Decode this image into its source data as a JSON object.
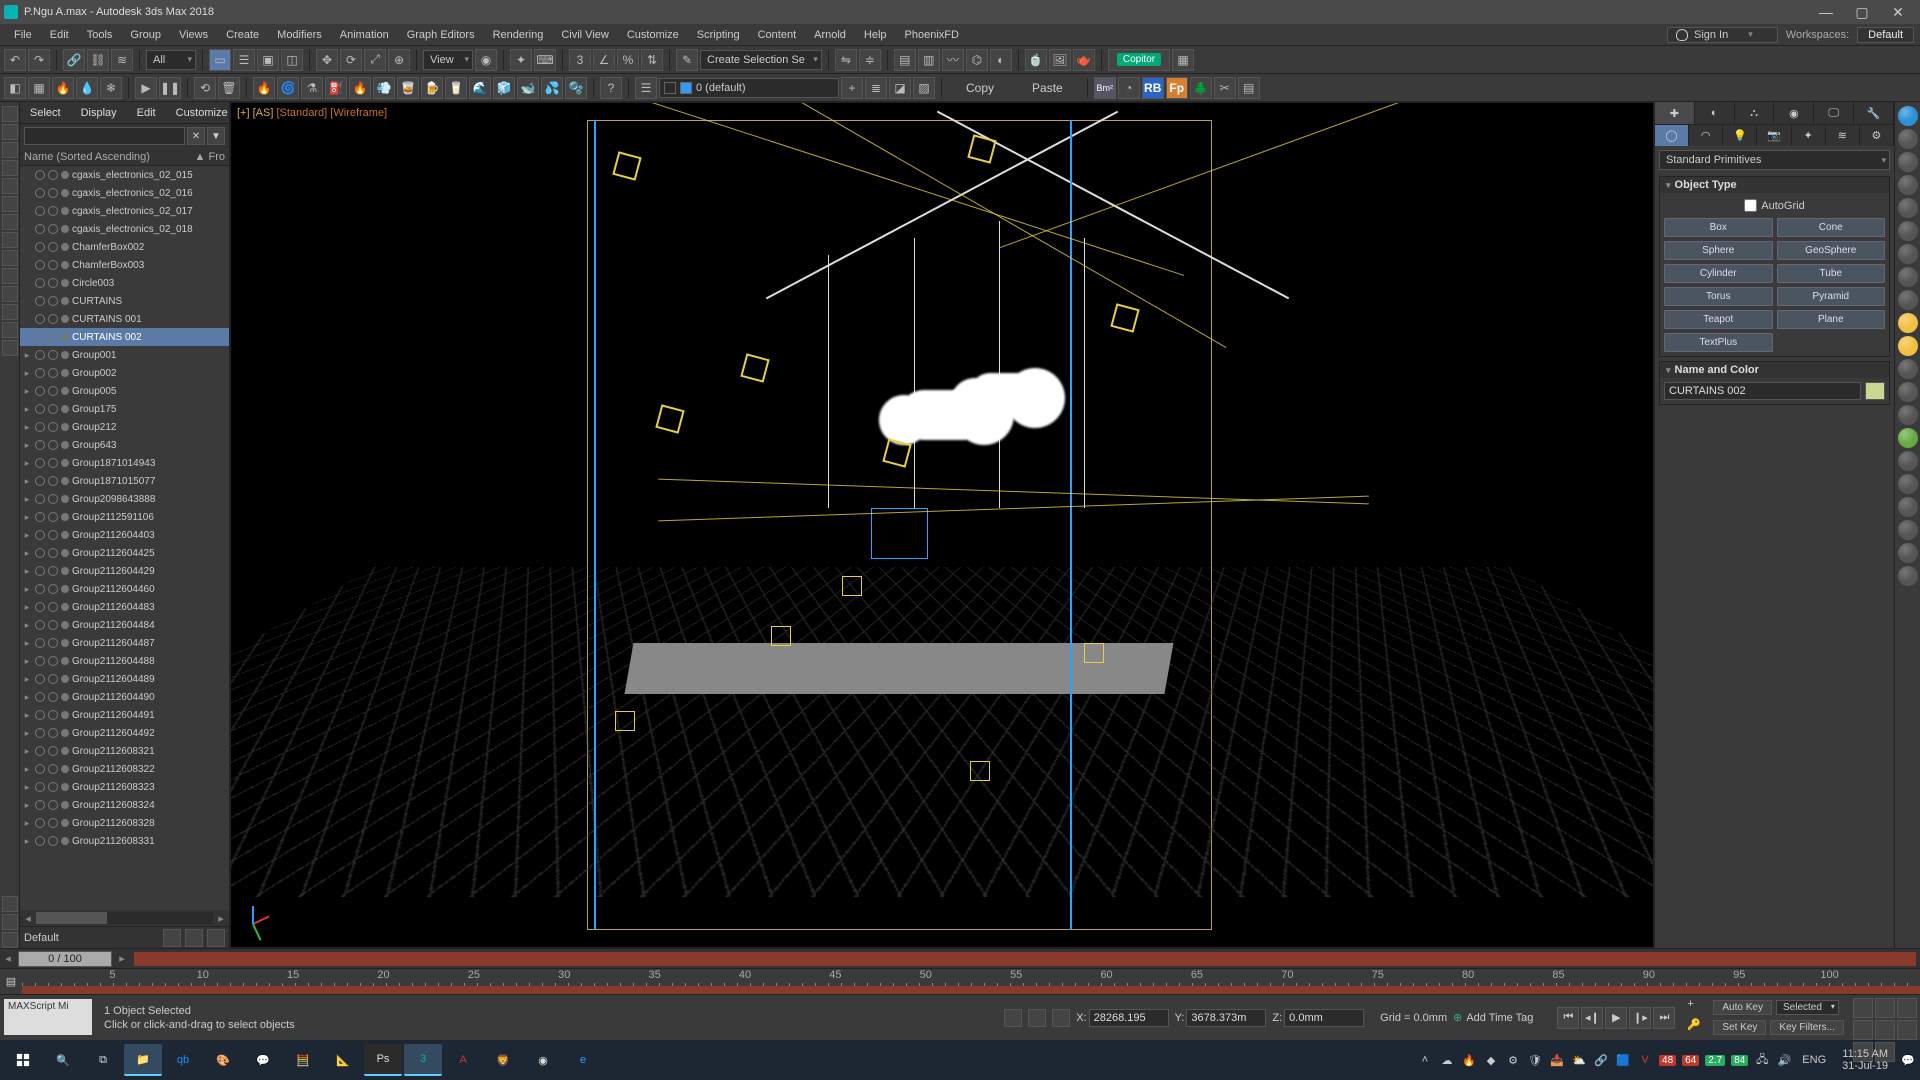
{
  "title": "P.Ngu A.max - Autodesk 3ds Max 2018",
  "menus": [
    "File",
    "Edit",
    "Tools",
    "Group",
    "Views",
    "Create",
    "Modifiers",
    "Animation",
    "Graph Editors",
    "Rendering",
    "Civil View",
    "Customize",
    "Scripting",
    "Content",
    "Arnold",
    "Help",
    "PhoenixFD"
  ],
  "sign_in": "Sign In",
  "workspace_label": "Workspaces:",
  "workspace_value": "Default",
  "toolbar1": {
    "filter_all": "All",
    "view_label": "View",
    "create_sel": "Create Selection Se",
    "capitor": "Copitor"
  },
  "toolbar2": {
    "layer_default": "0 (default)",
    "copy": "Copy",
    "paste": "Paste"
  },
  "scene_tabs": [
    "Select",
    "Display",
    "Edit",
    "Customize"
  ],
  "scene_col": "Name (Sorted Ascending)",
  "scene_col2": "▲  Fro",
  "scene_items": [
    {
      "n": "cgaxis_electronics_02_015"
    },
    {
      "n": "cgaxis_electronics_02_016"
    },
    {
      "n": "cgaxis_electronics_02_017"
    },
    {
      "n": "cgaxis_electronics_02_018"
    },
    {
      "n": "ChamferBox002"
    },
    {
      "n": "ChamferBox003"
    },
    {
      "n": "Circle003"
    },
    {
      "n": "CURTAINS"
    },
    {
      "n": "CURTAINS 001"
    },
    {
      "n": "CURTAINS 002",
      "sel": true
    },
    {
      "n": "Group001",
      "g": true
    },
    {
      "n": "Group002",
      "g": true
    },
    {
      "n": "Group005",
      "g": true
    },
    {
      "n": "Group175",
      "g": true
    },
    {
      "n": "Group212",
      "g": true
    },
    {
      "n": "Group643",
      "g": true
    },
    {
      "n": "Group1871014943",
      "g": true
    },
    {
      "n": "Group1871015077",
      "g": true
    },
    {
      "n": "Group2098643888",
      "g": true
    },
    {
      "n": "Group2112591106",
      "g": true
    },
    {
      "n": "Group2112604403",
      "g": true
    },
    {
      "n": "Group2112604425",
      "g": true
    },
    {
      "n": "Group2112604429",
      "g": true
    },
    {
      "n": "Group2112604460",
      "g": true
    },
    {
      "n": "Group2112604483",
      "g": true
    },
    {
      "n": "Group2112604484",
      "g": true
    },
    {
      "n": "Group2112604487",
      "g": true
    },
    {
      "n": "Group2112604488",
      "g": true
    },
    {
      "n": "Group2112604489",
      "g": true
    },
    {
      "n": "Group2112604490",
      "g": true
    },
    {
      "n": "Group2112604491",
      "g": true
    },
    {
      "n": "Group2112604492",
      "g": true
    },
    {
      "n": "Group2112608321",
      "g": true
    },
    {
      "n": "Group2112608322",
      "g": true
    },
    {
      "n": "Group2112608323",
      "g": true
    },
    {
      "n": "Group2112608324",
      "g": true
    },
    {
      "n": "Group2112608328",
      "g": true
    },
    {
      "n": "Group2112608331",
      "g": true
    }
  ],
  "scene_footer": "Default",
  "viewport_label": {
    "a": "[+] [AS]",
    "b": "[Standard]",
    "c": "[Wireframe]"
  },
  "cmd": {
    "dropdown": "Standard Primitives",
    "rollout_objtype": "Object Type",
    "autogrid": "AutoGrid",
    "buttons": [
      "Box",
      "Cone",
      "Sphere",
      "GeoSphere",
      "Cylinder",
      "Tube",
      "Torus",
      "Pyramid",
      "Teapot",
      "Plane",
      "TextPlus"
    ],
    "rollout_name": "Name and Color",
    "obj_name": "CURTAINS 002"
  },
  "timeslider": "0 / 100",
  "ruler_ticks": [
    "5",
    "10",
    "15",
    "20",
    "25",
    "30",
    "35",
    "40",
    "45",
    "50",
    "55",
    "60",
    "65",
    "70",
    "75",
    "80",
    "85",
    "90",
    "95",
    "100"
  ],
  "status": {
    "mx": "MAXScript Mi",
    "line1": "1 Object Selected",
    "line2": "Click or click-and-drag to select objects",
    "x": "28268.195",
    "y": "3678.373m",
    "z": "0.0mm",
    "grid": "Grid = 0.0mm",
    "addtag": "Add Time Tag",
    "autokey": "Auto Key",
    "selected": "Selected",
    "setkey": "Set Key",
    "keyfilters": "Key Filters..."
  },
  "tray": {
    "t1": "48",
    "t2": "64",
    "t3": "2.7",
    "t4": "84",
    "lang": "ENG",
    "time": "11:15 AM",
    "date": "31-Jul-19"
  }
}
